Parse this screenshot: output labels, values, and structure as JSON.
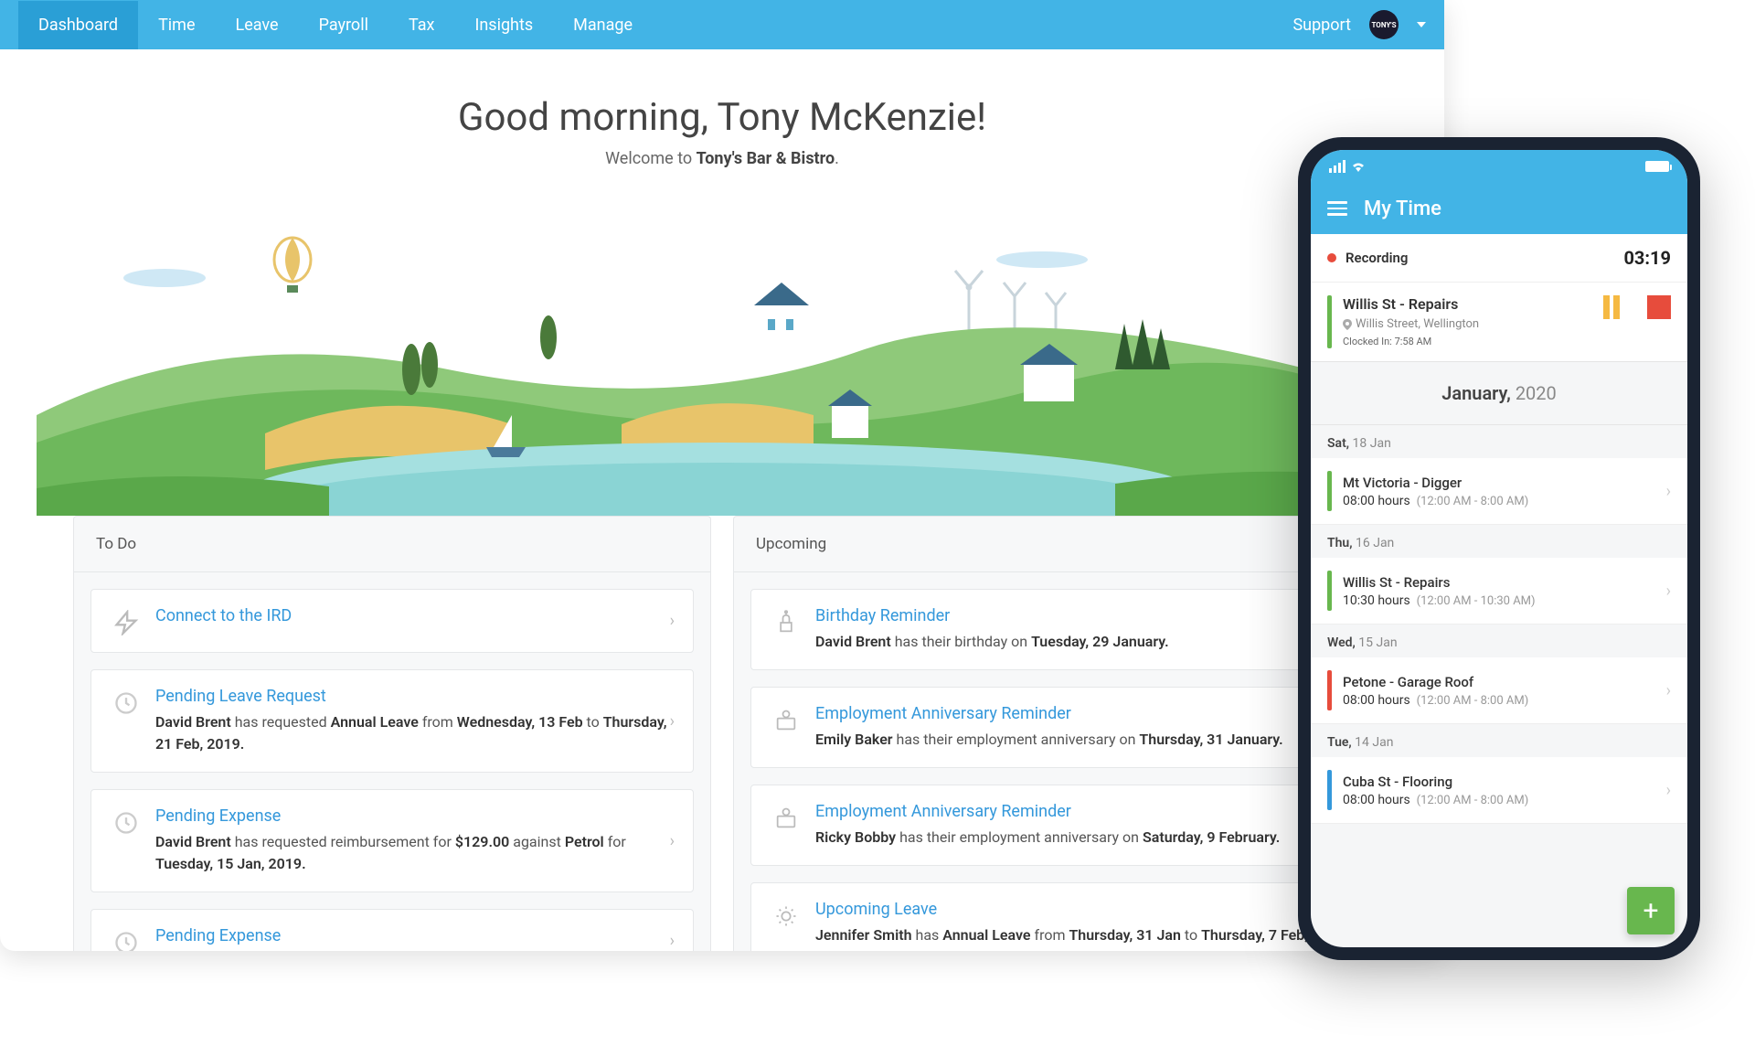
{
  "nav": {
    "items": [
      "Dashboard",
      "Time",
      "Leave",
      "Payroll",
      "Tax",
      "Insights",
      "Manage"
    ],
    "support": "Support",
    "avatar_text": "TONY'S"
  },
  "hero": {
    "greeting": "Good morning, Tony McKenzie!",
    "welcome_prefix": "Welcome to ",
    "business_name": "Tony's Bar & Bistro",
    "welcome_suffix": "."
  },
  "todo": {
    "header": "To Do",
    "items": [
      {
        "title": "Connect to the IRD",
        "desc_html": ""
      },
      {
        "title": "Pending Leave Request",
        "desc_html": "<strong>David Brent</strong> has requested <strong>Annual Leave</strong> from <strong>Wednesday, 13 Feb</strong> to <strong>Thursday, 21 Feb, 2019.</strong>"
      },
      {
        "title": "Pending Expense",
        "desc_html": "<strong>David Brent</strong> has requested reimbursement for <strong>$129.00</strong> against <strong>Petrol</strong> for <strong>Tuesday, 15 Jan, 2019.</strong>"
      },
      {
        "title": "Pending Expense",
        "desc_html": ""
      }
    ]
  },
  "upcoming": {
    "header": "Upcoming",
    "items": [
      {
        "title": "Birthday Reminder",
        "desc_html": "<strong>David Brent</strong> has their birthday on <strong>Tuesday, 29 January.</strong>"
      },
      {
        "title": "Employment Anniversary Reminder",
        "desc_html": "<strong>Emily Baker</strong> has their employment anniversary on <strong>Thursday, 31 January.</strong>"
      },
      {
        "title": "Employment Anniversary Reminder",
        "desc_html": "<strong>Ricky Bobby</strong> has their employment anniversary on <strong>Saturday, 9 February.</strong>"
      },
      {
        "title": "Upcoming Leave",
        "desc_html": "<strong>Jennifer Smith</strong> has <strong>Annual Leave</strong> from <strong>Thursday, 31 Jan</strong> to <strong>Thursday, 7 Feb,</strong>"
      }
    ]
  },
  "phone": {
    "title": "My Time",
    "recording_label": "Recording",
    "recording_time": "03:19",
    "active": {
      "name": "Willis St - Repairs",
      "location": "Willis Street, Wellington",
      "clocked_label": "Clocked In: ",
      "clocked_time": "7:58 AM"
    },
    "month": "January,",
    "year": "2020",
    "days": [
      {
        "dow": "Sat,",
        "date": "18 Jan",
        "entries": [
          {
            "color": "green",
            "name": "Mt Victoria - Digger",
            "hours": "08:00 hours",
            "range": "(12:00 AM - 8:00 AM)"
          }
        ]
      },
      {
        "dow": "Thu,",
        "date": "16 Jan",
        "entries": [
          {
            "color": "green",
            "name": "Willis St - Repairs",
            "hours": "10:30 hours",
            "range": "(12:00 AM - 10:30 AM)"
          }
        ]
      },
      {
        "dow": "Wed,",
        "date": "15 Jan",
        "entries": [
          {
            "color": "red",
            "name": "Petone - Garage Roof",
            "hours": "08:00 hours",
            "range": "(12:00 AM - 8:00 AM)"
          }
        ]
      },
      {
        "dow": "Tue,",
        "date": "14 Jan",
        "entries": [
          {
            "color": "blue",
            "name": "Cuba St - Flooring",
            "hours": "08:00 hours",
            "range": "(12:00 AM - 8:00 AM)"
          }
        ]
      }
    ]
  }
}
